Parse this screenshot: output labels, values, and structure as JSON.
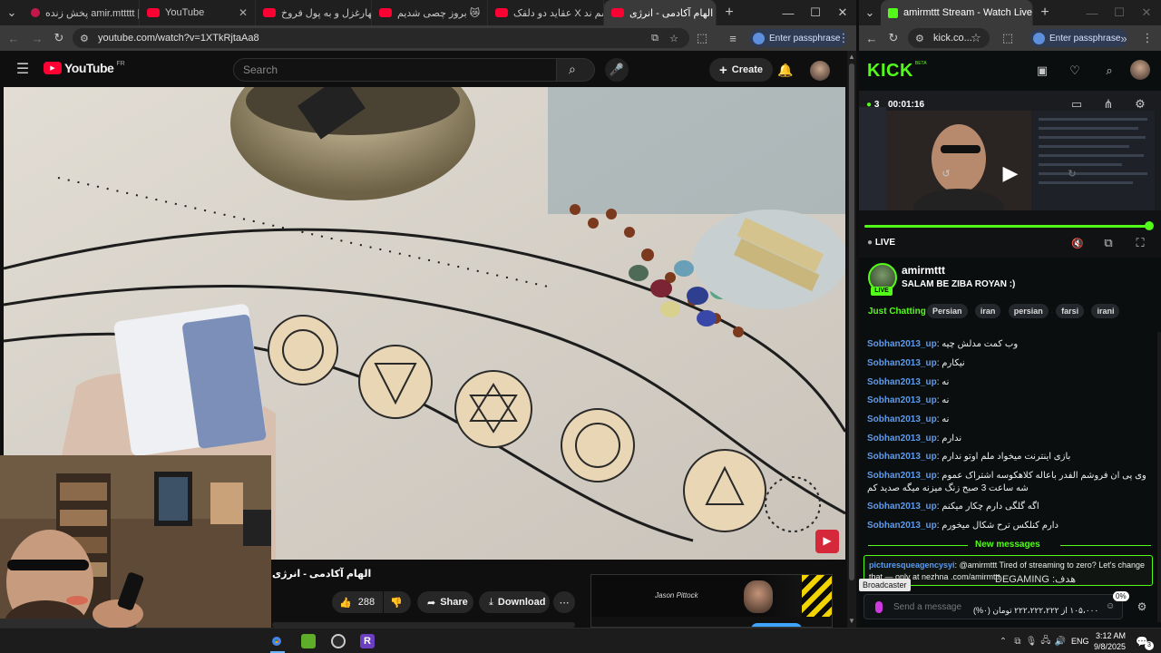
{
  "left_browser": {
    "tabs": [
      {
        "label": "پخش زنده amir.mttttt |"
      },
      {
        "label": "YouTube"
      },
      {
        "label": "مهارغزل و به پول فروخ..."
      },
      {
        "label": "بروز چصی شدیم 😿"
      },
      {
        "label": "عقاید دو دلقک X اسم ند..."
      },
      {
        "label": "الهام آکادمی - انرژی"
      }
    ],
    "url": "youtube.com/watch?v=1XTkRjtaAa8",
    "passphrase_label": "Enter passphrase"
  },
  "youtube": {
    "logo_text": "YouTube",
    "region": "FR",
    "search_placeholder": "Search",
    "create_label": "Create",
    "video_title": "الهام آکادمی - انرژی",
    "like_count": "288",
    "share_label": "Share",
    "download_label": "Download",
    "ad_name": "Jason Pittock"
  },
  "right_browser": {
    "tab_label": "amirmttt Stream - Watch Live o",
    "url": "kick.co...",
    "passphrase_label": "Enter passphrase"
  },
  "kick": {
    "logo_text": "KICK",
    "beta": "BETA",
    "viewers": "3",
    "elapsed": "00:01:16",
    "live_label": "LIVE",
    "channel_name": "amirmttt",
    "stream_title": "SALAM BE ZIBA ROYAN :)",
    "avatar_live": "LIVE",
    "category": "Just Chatting",
    "tags": [
      "Persian",
      "iran",
      "persian",
      "farsi",
      "irani"
    ],
    "messages": [
      {
        "user": "Sobhan2013_up",
        "text": "وب کمت مدلش چیه"
      },
      {
        "user": "Sobhan2013_up",
        "text": "نیکارم"
      },
      {
        "user": "Sobhan2013_up",
        "text": "نه"
      },
      {
        "user": "Sobhan2013_up",
        "text": "نه"
      },
      {
        "user": "Sobhan2013_up",
        "text": "نه"
      },
      {
        "user": "Sobhan2013_up",
        "text": "ندارم"
      },
      {
        "user": "Sobhan2013_up",
        "text": "بازی اینترنت میخواد ملم اوتو ندارم"
      },
      {
        "user": "Sobhan2013_up",
        "text": "وی پی ان فروشم الفدر باعاله کلاهکوسه اشتراک عموم شه ساعت 3 صبح زنگ میزنه میگه صدید کم"
      },
      {
        "user": "Sobhan2013_up",
        "text": "اگه گلگی دارم چکار میکنم"
      },
      {
        "user": "Sobhan2013_up",
        "text": "دارم کنلکس ترح شکال میخورم"
      }
    ],
    "new_messages_label": "New messages",
    "pinned": {
      "user": "picturesqueagencysyi",
      "text": "@amirmttt Tired of streaming to zero? Let's change that — only at nezhna .com/amirmttt"
    },
    "goal_overlay": "هدف: DEGAMING",
    "broadcaster_label": "Broadcaster",
    "send_placeholder": "Send a message",
    "donation_text": "۱۰۵،۰۰۰ از ۲۲۲،۲۲۲،۲۲۲ تومان (۰%)",
    "donation_percent": "0%"
  },
  "taskbar": {
    "lang": "ENG",
    "time": "3:12 AM",
    "date": "9/8/2025",
    "notif_count": "3"
  }
}
